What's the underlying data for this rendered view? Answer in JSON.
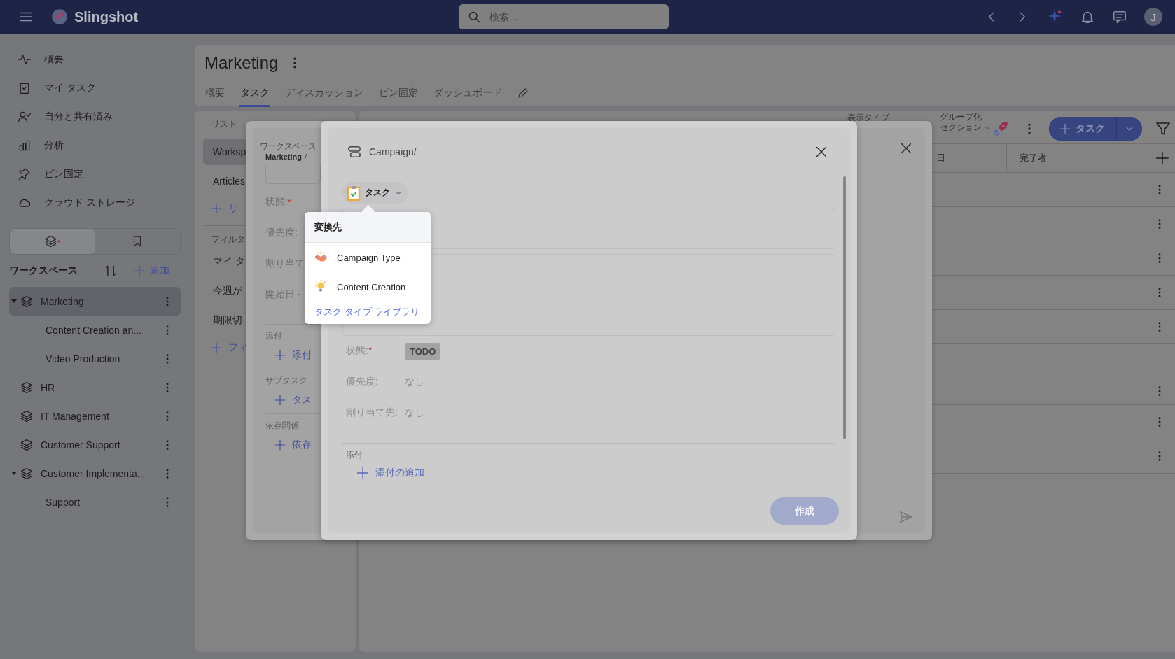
{
  "top_bar": {
    "app_name": "Slingshot",
    "search": {
      "placeholder": "検索..."
    },
    "avatar": "J"
  },
  "sidebar": {
    "nav": [
      {
        "label": "概要",
        "kind": "pulse"
      },
      {
        "label": "マイ タスク",
        "kind": "task"
      },
      {
        "label": "自分と共有済み",
        "kind": "shared"
      },
      {
        "label": "分析",
        "kind": "chart"
      },
      {
        "label": "ピン固定",
        "kind": "pin"
      },
      {
        "label": "クラウド ストレージ",
        "kind": "cloud"
      }
    ],
    "view_toggle": [
      {
        "kind": "workspaces",
        "selected": true
      },
      {
        "kind": "bookmarks",
        "selected": false
      }
    ],
    "workspaces_title": "ワークスペース",
    "add_label": "追加",
    "tree": [
      {
        "label": "Marketing",
        "selected": true,
        "expanded": true,
        "children": [
          {
            "label": "Content Creation an...",
            "selected": false
          },
          {
            "label": "Video Production",
            "selected": false
          }
        ]
      },
      {
        "label": "HR",
        "selected": false
      },
      {
        "label": "IT Management",
        "selected": false
      },
      {
        "label": "Customer Support",
        "selected": false
      },
      {
        "label": "Customer Implementa...",
        "selected": false,
        "expanded": true,
        "children": [
          {
            "label": "Support",
            "selected": false
          }
        ]
      }
    ]
  },
  "project": {
    "title": "Marketing",
    "tabs": [
      {
        "label": "概要",
        "selected": false
      },
      {
        "label": "タスク",
        "selected": true
      },
      {
        "label": "ディスカッション",
        "selected": false
      },
      {
        "label": "ピン固定",
        "selected": false
      },
      {
        "label": "ダッシュボード",
        "selected": false
      }
    ]
  },
  "list_panel": {
    "heading": "リスト",
    "lists": [
      {
        "label": "Worksp",
        "selected": true
      },
      {
        "label": "Articles",
        "selected": false
      }
    ],
    "add_list": "リ",
    "filter_heading": "フィルタ",
    "filters": [
      "マイ タ",
      "今週が",
      "期限切"
    ],
    "add_filter": "フィ"
  },
  "task_table": {
    "toolbar": {
      "view_type": "表示タイプ",
      "group_by": "グループ化",
      "group_value": "セクション",
      "new_task": "タスク"
    },
    "columns": [
      {
        "label": "日"
      },
      {
        "label": "完了者"
      }
    ],
    "rows": [
      {
        "kind": "task"
      },
      {
        "kind": "task"
      },
      {
        "kind": "task"
      },
      {
        "kind": "task"
      },
      {
        "kind": "task"
      },
      {
        "kind": "tall"
      },
      {
        "kind": "task"
      },
      {
        "kind": "task"
      }
    ]
  },
  "back_dialog": {
    "breadcrumb": [
      {
        "caption": "ワークスペース",
        "value": "Marketing"
      }
    ],
    "breadcrumb_separator": "/",
    "fields": [
      {
        "label": "状態:",
        "required_mark": "*"
      },
      {
        "label": "優先度:"
      },
      {
        "label": "割り当て"
      },
      {
        "label": "開始日 -"
      }
    ],
    "sections": [
      {
        "heading": "添付",
        "action": "添付"
      },
      {
        "heading": "サブタスク",
        "action": "タス"
      },
      {
        "heading": "依存関係",
        "action": "依存"
      }
    ]
  },
  "task_dialog": {
    "path": "Campaign/",
    "type_label": "タスク",
    "fields": [
      {
        "label": "状態:",
        "required_mark": "*",
        "kind": "status",
        "value": "TODO"
      },
      {
        "label": "優先度:",
        "kind": "text",
        "value": "なし"
      },
      {
        "label": "割り当て先:",
        "kind": "text",
        "value": "なし"
      }
    ],
    "attachments": {
      "heading": "添付",
      "action": "添付の追加"
    },
    "create_button": {
      "label": "作成",
      "disabled": true
    }
  },
  "convert_menu": {
    "heading": "変換先",
    "items": [
      {
        "label": "Campaign Type",
        "kind": "handshake"
      },
      {
        "label": "Content Creation",
        "kind": "bulb"
      }
    ],
    "library_link": "タスク タイプ ライブラリ"
  }
}
